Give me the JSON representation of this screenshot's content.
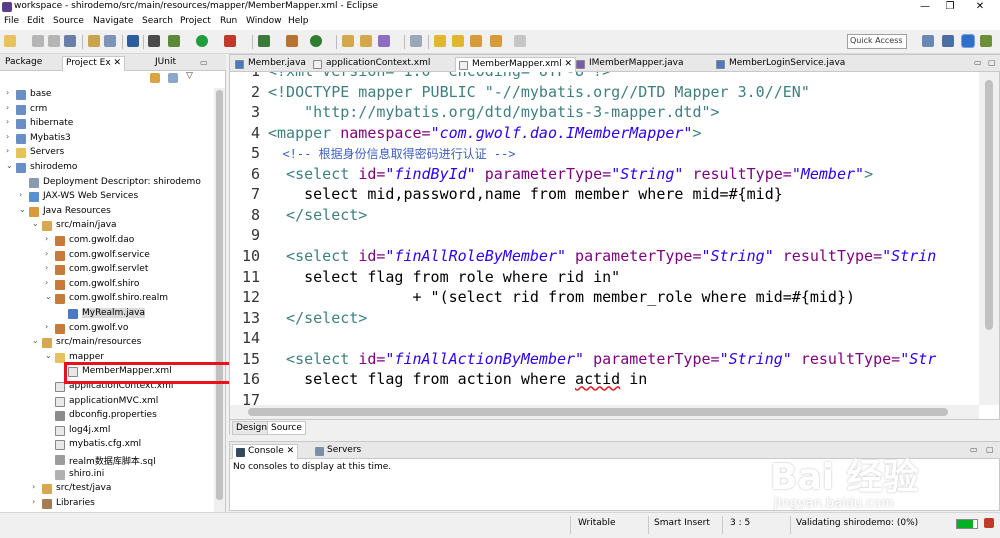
{
  "window": {
    "title": "workspace - shirodemo/src/main/resources/mapper/MemberMapper.xml - Eclipse",
    "controls": [
      "—",
      "❐",
      "✕"
    ]
  },
  "menu": [
    "File",
    "Edit",
    "Source",
    "Navigate",
    "Search",
    "Project",
    "Run",
    "Window",
    "Help"
  ],
  "toolbar": {
    "quick_access_placeholder": "Quick Access"
  },
  "left_view": {
    "tabs": [
      "Package",
      "Project Ex",
      "JUnit"
    ],
    "tree": [
      {
        "label": "base",
        "depth": 0,
        "expanded": false,
        "icon": "project-icon"
      },
      {
        "label": "crm",
        "depth": 0,
        "expanded": false,
        "icon": "project-icon"
      },
      {
        "label": "hibernate",
        "depth": 0,
        "expanded": false,
        "icon": "project-icon"
      },
      {
        "label": "Mybatis3",
        "depth": 0,
        "expanded": false,
        "icon": "project-icon"
      },
      {
        "label": "Servers",
        "depth": 0,
        "expanded": false,
        "icon": "folder-icon"
      },
      {
        "label": "shirodemo",
        "depth": 0,
        "expanded": true,
        "icon": "project-icon"
      },
      {
        "label": "Deployment Descriptor: shirodemo",
        "depth": 1,
        "expanded": false,
        "icon": "descriptor-icon"
      },
      {
        "label": "JAX-WS Web Services",
        "depth": 1,
        "expanded": false,
        "icon": "webservice-icon"
      },
      {
        "label": "Java Resources",
        "depth": 1,
        "expanded": true,
        "icon": "java-resources-icon"
      },
      {
        "label": "src/main/java",
        "depth": 2,
        "expanded": true,
        "icon": "source-folder-icon"
      },
      {
        "label": "com.gwolf.dao",
        "depth": 3,
        "expanded": false,
        "icon": "package-icon"
      },
      {
        "label": "com.gwolf.service",
        "depth": 3,
        "expanded": false,
        "icon": "package-icon"
      },
      {
        "label": "com.gwolf.servlet",
        "depth": 3,
        "expanded": false,
        "icon": "package-icon"
      },
      {
        "label": "com.gwolf.shiro",
        "depth": 3,
        "expanded": false,
        "icon": "package-icon"
      },
      {
        "label": "com.gwolf.shiro.realm",
        "depth": 3,
        "expanded": true,
        "icon": "package-icon"
      },
      {
        "label": "MyRealm.java",
        "depth": 4,
        "expanded": false,
        "icon": "java-file-icon"
      },
      {
        "label": "com.gwolf.vo",
        "depth": 3,
        "expanded": false,
        "icon": "package-icon"
      },
      {
        "label": "src/main/resources",
        "depth": 2,
        "expanded": true,
        "icon": "source-folder-icon"
      },
      {
        "label": "mapper",
        "depth": 3,
        "expanded": true,
        "icon": "folder-icon"
      },
      {
        "label": "MemberMapper.xml",
        "depth": 4,
        "expanded": false,
        "icon": "xml-file-icon"
      },
      {
        "label": "applicationContext.xml",
        "depth": 3,
        "expanded": false,
        "icon": "xml-file-icon"
      },
      {
        "label": "applicationMVC.xml",
        "depth": 3,
        "expanded": false,
        "icon": "xml-file-icon"
      },
      {
        "label": "dbconfig.properties",
        "depth": 3,
        "expanded": false,
        "icon": "properties-file-icon"
      },
      {
        "label": "log4j.xml",
        "depth": 3,
        "expanded": false,
        "icon": "xml-file-icon"
      },
      {
        "label": "mybatis.cfg.xml",
        "depth": 3,
        "expanded": false,
        "icon": "xml-file-icon"
      },
      {
        "label": "realm数据库脚本.sql",
        "depth": 3,
        "expanded": false,
        "icon": "sql-file-icon"
      },
      {
        "label": "shiro.ini",
        "depth": 3,
        "expanded": false,
        "icon": "ini-file-icon"
      },
      {
        "label": "src/test/java",
        "depth": 2,
        "expanded": false,
        "icon": "source-folder-icon"
      },
      {
        "label": "Libraries",
        "depth": 2,
        "expanded": false,
        "icon": "library-icon"
      }
    ]
  },
  "editor": {
    "tabs": [
      {
        "label": "Member.java",
        "active": false
      },
      {
        "label": "applicationContext.xml",
        "active": false
      },
      {
        "label": "MemberMapper.xml",
        "active": true
      },
      {
        "label": "IMemberMapper.java",
        "active": false
      },
      {
        "label": "MemberLoginService.java",
        "active": false
      }
    ],
    "lines": [
      {
        "n": "1",
        "parts": [
          {
            "t": "<?xml version=\"1.0\" encoding=\"UTF-8\"?>",
            "c": "kw"
          }
        ]
      },
      {
        "n": "2",
        "parts": [
          {
            "t": "<!DOCTYPE mapper PUBLIC \"-//mybatis.org//DTD Mapper 3.0//EN\"",
            "c": "kw"
          }
        ]
      },
      {
        "n": "3",
        "parts": [
          {
            "t": "    \"http://mybatis.org/dtd/mybatis-3-mapper.dtd\">",
            "c": "kw"
          }
        ]
      },
      {
        "n": "4",
        "parts": [
          {
            "t": "<mapper ",
            "c": "kw"
          },
          {
            "t": "namespace=",
            "c": "at"
          },
          {
            "t": "\"com.gwolf.dao.IMemberMapper\"",
            "c": "vl"
          },
          {
            "t": ">",
            "c": "kw"
          }
        ]
      },
      {
        "n": "5",
        "parts": [
          {
            "t": "  <!-- ",
            "c": "cm"
          },
          {
            "t": "根据身份信息取得密码进行认证",
            "c": "cm"
          },
          {
            "t": " -->",
            "c": "cm"
          }
        ]
      },
      {
        "n": "6",
        "parts": [
          {
            "t": "  <select ",
            "c": "kw"
          },
          {
            "t": "id=",
            "c": "at"
          },
          {
            "t": "\"findById\"",
            "c": "vl"
          },
          {
            "t": " parameterType=",
            "c": "at"
          },
          {
            "t": "\"String\"",
            "c": "vl"
          },
          {
            "t": " resultType=",
            "c": "at"
          },
          {
            "t": "\"Member\"",
            "c": "vl"
          },
          {
            "t": ">",
            "c": "kw"
          }
        ]
      },
      {
        "n": "7",
        "parts": [
          {
            "t": "    select mid,password,name from member where mid=#{mid}",
            "c": ""
          }
        ]
      },
      {
        "n": "8",
        "parts": [
          {
            "t": "  </select>",
            "c": "kw"
          }
        ]
      },
      {
        "n": "9",
        "parts": [
          {
            "t": "",
            "c": ""
          }
        ]
      },
      {
        "n": "10",
        "parts": [
          {
            "t": "  <select ",
            "c": "kw"
          },
          {
            "t": "id=",
            "c": "at"
          },
          {
            "t": "\"finAllRoleByMember\"",
            "c": "vl"
          },
          {
            "t": " parameterType=",
            "c": "at"
          },
          {
            "t": "\"String\"",
            "c": "vl"
          },
          {
            "t": " resultType=",
            "c": "at"
          },
          {
            "t": "\"Strin",
            "c": "vl"
          }
        ]
      },
      {
        "n": "11",
        "parts": [
          {
            "t": "    select flag from role where rid in\"",
            "c": ""
          }
        ]
      },
      {
        "n": "12",
        "parts": [
          {
            "t": "                + \"(select rid from member_role where mid=#{mid})",
            "c": ""
          }
        ]
      },
      {
        "n": "13",
        "parts": [
          {
            "t": "  </select>",
            "c": "kw"
          }
        ]
      },
      {
        "n": "14",
        "parts": [
          {
            "t": "",
            "c": ""
          }
        ]
      },
      {
        "n": "15",
        "parts": [
          {
            "t": "  <select ",
            "c": "kw"
          },
          {
            "t": "id=",
            "c": "at"
          },
          {
            "t": "\"finAllActionByMember\"",
            "c": "vl"
          },
          {
            "t": " parameterType=",
            "c": "at"
          },
          {
            "t": "\"String\"",
            "c": "vl"
          },
          {
            "t": " resultType=",
            "c": "at"
          },
          {
            "t": "\"Str",
            "c": "vl"
          }
        ]
      },
      {
        "n": "16",
        "parts": [
          {
            "t": "    select flag from action where ",
            "c": ""
          },
          {
            "t": "actid",
            "c": "sq"
          },
          {
            "t": " in",
            "c": ""
          }
        ]
      },
      {
        "n": "17",
        "parts": [
          {
            "t": "",
            "c": ""
          }
        ]
      }
    ],
    "bottom_tabs": [
      "Design",
      "Source"
    ]
  },
  "console": {
    "tabs": [
      "Console",
      "Servers"
    ],
    "message": "No consoles to display at this time."
  },
  "status": {
    "writable": "Writable",
    "insert_mode": "Smart Insert",
    "cursor": "3 : 5",
    "task": "Validating shirodemo: (0%)"
  },
  "watermark": {
    "main": "Bai 经验",
    "sub": "jingyan.baidu.com"
  },
  "colors": {
    "highlight": "#e8121c",
    "tag": "#3f7f7f",
    "attr": "#7f007f",
    "value": "#2a00ff",
    "comment": "#3f5fbf"
  }
}
